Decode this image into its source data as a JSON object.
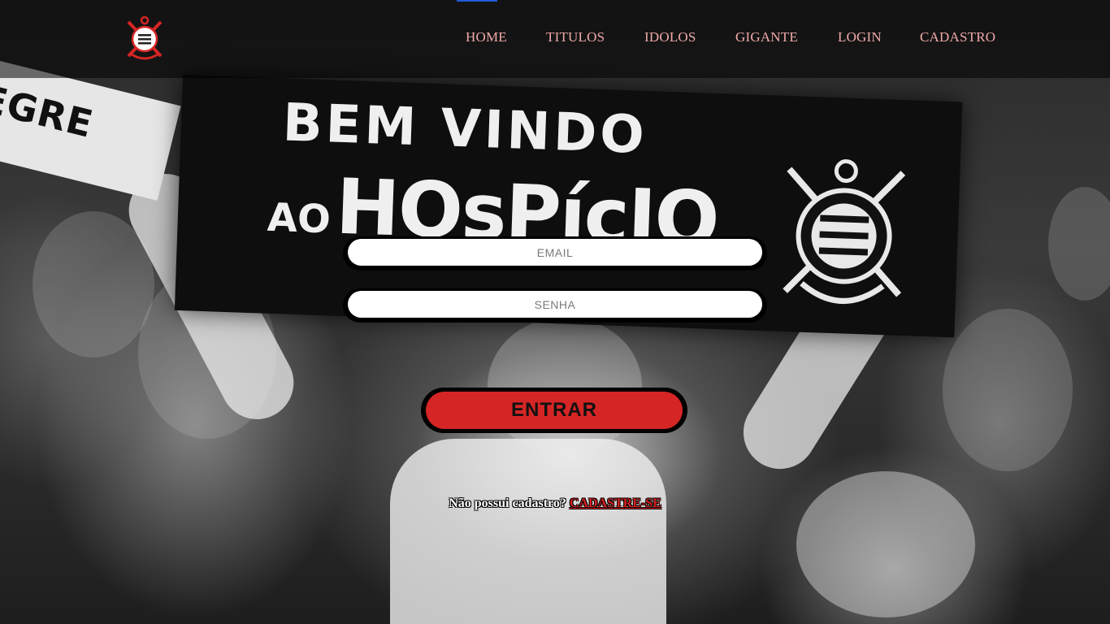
{
  "header": {
    "logo_icon": "corinthians-crest-icon",
    "nav": [
      {
        "label": "HOME"
      },
      {
        "label": "TITULOS"
      },
      {
        "label": "IDOLOS"
      },
      {
        "label": "GIGANTE"
      },
      {
        "label": "LOGIN"
      },
      {
        "label": "CADASTRO"
      }
    ]
  },
  "background": {
    "scarf_line1": "BEM VINDO",
    "scarf_line2_prefix": "AO",
    "scarf_line2_main": "HOsPícIO",
    "left_scarf_text": "EGRE"
  },
  "login_form": {
    "email_placeholder": "EMAIL",
    "password_placeholder": "SENHA",
    "submit_label": "ENTRAR"
  },
  "signup": {
    "prompt": "Não possui cadastro?",
    "link_label": "CADASTRE-SE"
  },
  "colors": {
    "nav_text": "#f1a9a9",
    "button": "#d62525",
    "signup_link": "#d62020",
    "header_overlay": "rgba(0,0,0,0.55)"
  }
}
